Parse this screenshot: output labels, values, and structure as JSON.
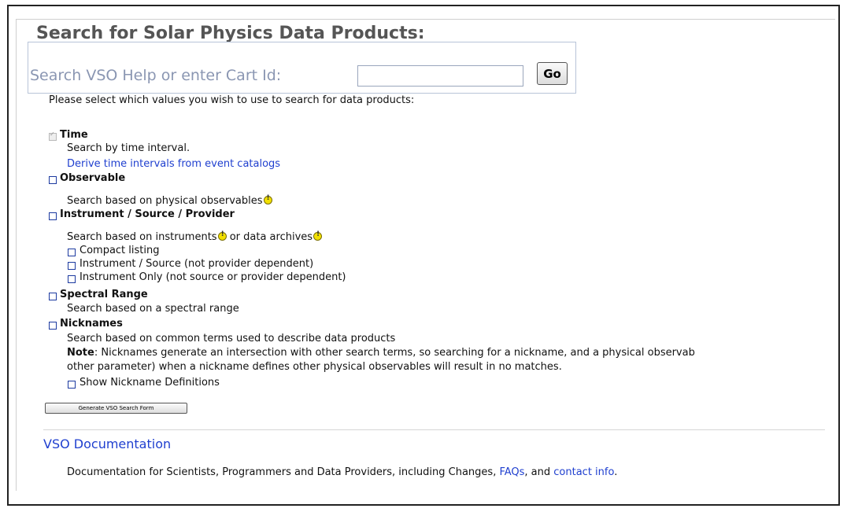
{
  "page": {
    "title": "Search for Solar Physics Data Products:",
    "intro": "Please select which values you wish to use to search for data products:"
  },
  "search": {
    "label": "Search VSO Help or enter Cart Id:",
    "value": "",
    "placeholder": "",
    "go_label": "Go"
  },
  "sections": {
    "time": {
      "title": "Time",
      "checked": true,
      "description": "Search by time interval.",
      "link": "Derive time intervals from event catalogs"
    },
    "observable": {
      "title": "Observable",
      "checked": false,
      "description": "Search based on physical observables",
      "icon": "info-icon"
    },
    "instrument": {
      "title": "Instrument / Source / Provider",
      "checked": false,
      "description_a": "Search based on instruments",
      "description_b": " or data archives",
      "options": [
        "Compact listing",
        "Instrument / Source (not provider dependent)",
        "Instrument Only (not source or provider dependent)"
      ]
    },
    "spectral": {
      "title": "Spectral Range",
      "checked": false,
      "description": "Search based on a spectral range"
    },
    "nicknames": {
      "title": "Nicknames",
      "checked": false,
      "description": "Search based on common terms used to describe data products",
      "note_label": "Note",
      "note_line1": ": Nicknames generate an intersection with other search terms, so searching for a nickname, and a physical observab",
      "note_line2": "other parameter) when a nickname defines other physical observables will result in no matches.",
      "show_definitions": "Show Nickname Definitions"
    }
  },
  "generate_button": "Generate VSO Search Form",
  "documentation": {
    "title": "VSO Documentation",
    "text_before": "Documentation for Scientists, Programmers and Data Providers, including Changes, ",
    "faqs_link": "FAQs",
    "text_middle": ", and ",
    "contact_link": "contact info",
    "text_after": "."
  },
  "colors": {
    "link": "#1f3fcf",
    "title": "#555555",
    "search_label": "#8a96b2",
    "info_icon": "#f2e000"
  }
}
